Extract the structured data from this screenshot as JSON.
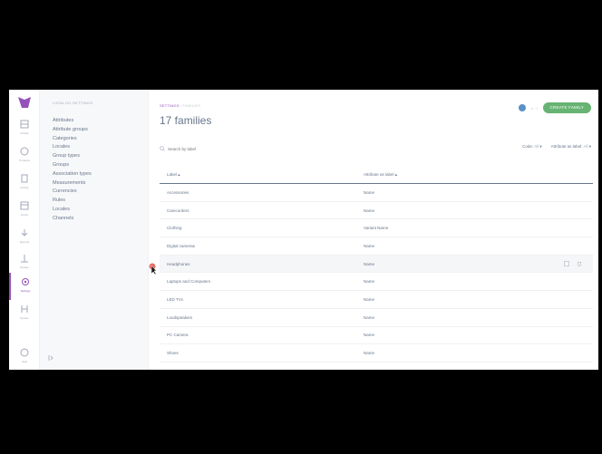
{
  "rail": {
    "items": [
      {
        "label": "Activity",
        "icon": "dashboard-icon"
      },
      {
        "label": "Products",
        "icon": "products-icon"
      },
      {
        "label": "Activity",
        "icon": "activity-icon"
      },
      {
        "label": "Import",
        "icon": "import-icon"
      },
      {
        "label": "Exports",
        "icon": "export-icon"
      },
      {
        "label": "System",
        "icon": "system-icon"
      },
      {
        "label": "Settings",
        "icon": "settings-icon",
        "active": true
      },
      {
        "label": "System",
        "icon": "system-icon-2"
      },
      {
        "label": "Help",
        "icon": "help-icon"
      }
    ]
  },
  "subnav": {
    "title": "Catalog settings",
    "items": [
      "Attributes",
      "Attribute groups",
      "Categories",
      "Locales",
      "Group types",
      "Groups",
      "Association types",
      "Measurements",
      "Currencies",
      "Rules",
      "Locales",
      "Channels"
    ]
  },
  "header": {
    "breadcrumb_a": "SETTINGS",
    "breadcrumb_sep": "/",
    "breadcrumb_b": "FAMILIES",
    "title": "17 families",
    "mini": "v · i",
    "create_label": "CREATE FAMILY"
  },
  "search": {
    "placeholder": "Search by label"
  },
  "filters": {
    "code_label": "Code",
    "code_value": "All",
    "attr_label": "Attribute as label",
    "attr_value": "All"
  },
  "table": {
    "headers": [
      "Label",
      "Attribute as label"
    ],
    "rows": [
      [
        "Accessories",
        "Name"
      ],
      [
        "Camcorders",
        "Name"
      ],
      [
        "Clothing",
        "Variant Name"
      ],
      [
        "Digital cameras",
        "Name"
      ],
      [
        "Headphones",
        "Name"
      ],
      [
        "Laptops and Computers",
        "Name"
      ],
      [
        "LED TVs",
        "Name"
      ],
      [
        "Loudspeakers",
        "Name"
      ],
      [
        "PC Camera",
        "Name"
      ],
      [
        "Shoes",
        "Name"
      ]
    ]
  },
  "colors": {
    "accent": "#9452ba",
    "create": "#67b373",
    "text": "#67768a"
  }
}
